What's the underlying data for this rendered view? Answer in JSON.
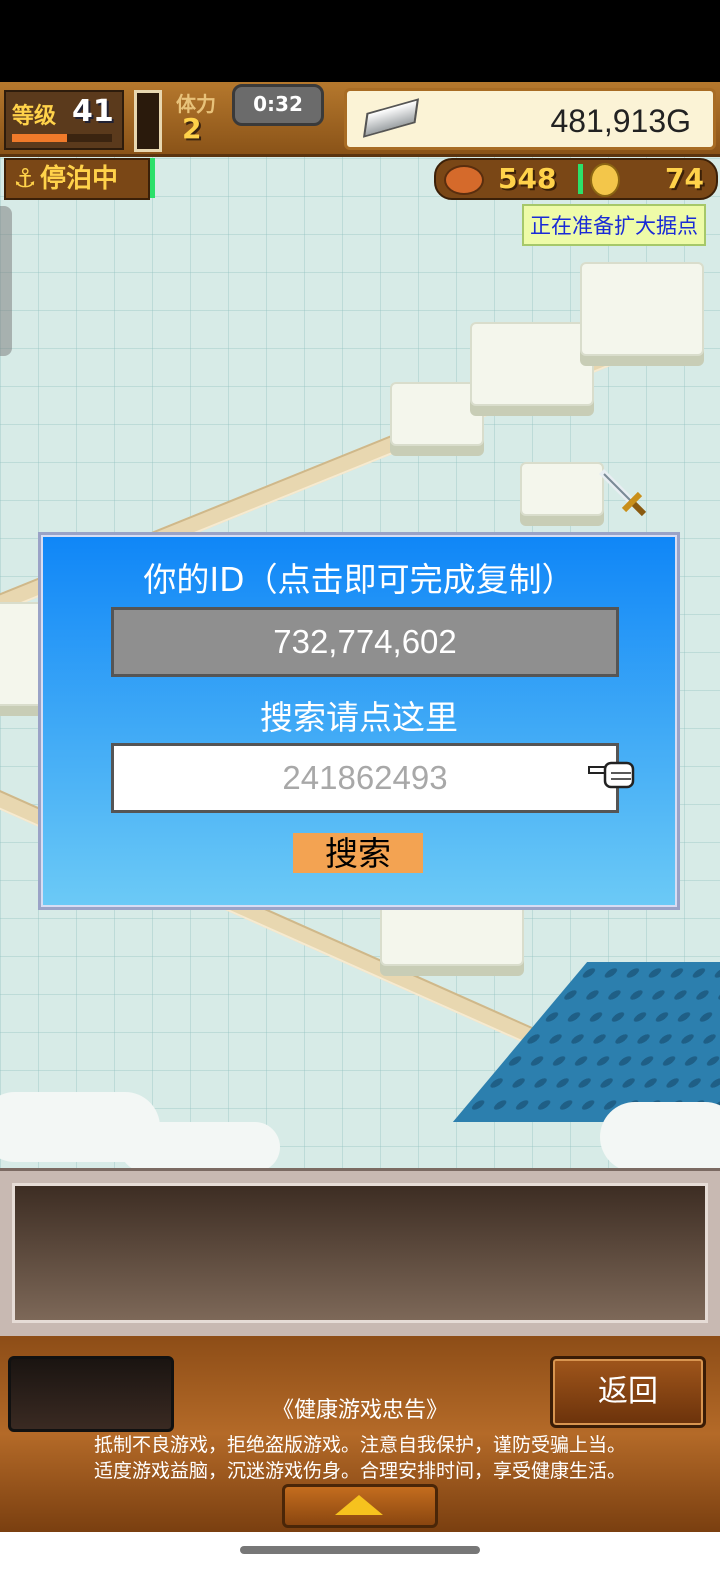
{
  "hud": {
    "level_label": "等级",
    "level_value": "41",
    "level_progress": 0.55,
    "stamina_label": "体力",
    "stamina_value": "2",
    "timer": "0:32",
    "gold": "481,913G",
    "docked_label": "停泊中",
    "food": "548",
    "coins": "74",
    "notice": "正在准备扩大据点"
  },
  "dialog": {
    "title": "你的ID（点击即可完成复制）",
    "user_id": "732,774,602",
    "search_hint": "搜索请点这里",
    "search_value": "241862493",
    "search_button": "搜索"
  },
  "footer": {
    "back_label": "返回",
    "health_title": "《健康游戏忠告》",
    "health_line1": "抵制不良游戏，拒绝盗版游戏。注意自我保护，谨防受骗上当。",
    "health_line2": "适度游戏益脑，沉迷游戏伤身。合理安排时间，享受健康生活。"
  },
  "icons": [
    "anchor-icon",
    "silver-ingot-icon",
    "food-icon",
    "coin-icon",
    "sword-icon",
    "pointer-hand-icon",
    "up-arrow-icon"
  ],
  "colors": {
    "dialog_top": "#0f86f7",
    "dialog_bottom": "#6ccaf6",
    "search_button": "#f3a352",
    "hud_brown": "#8a5318"
  }
}
